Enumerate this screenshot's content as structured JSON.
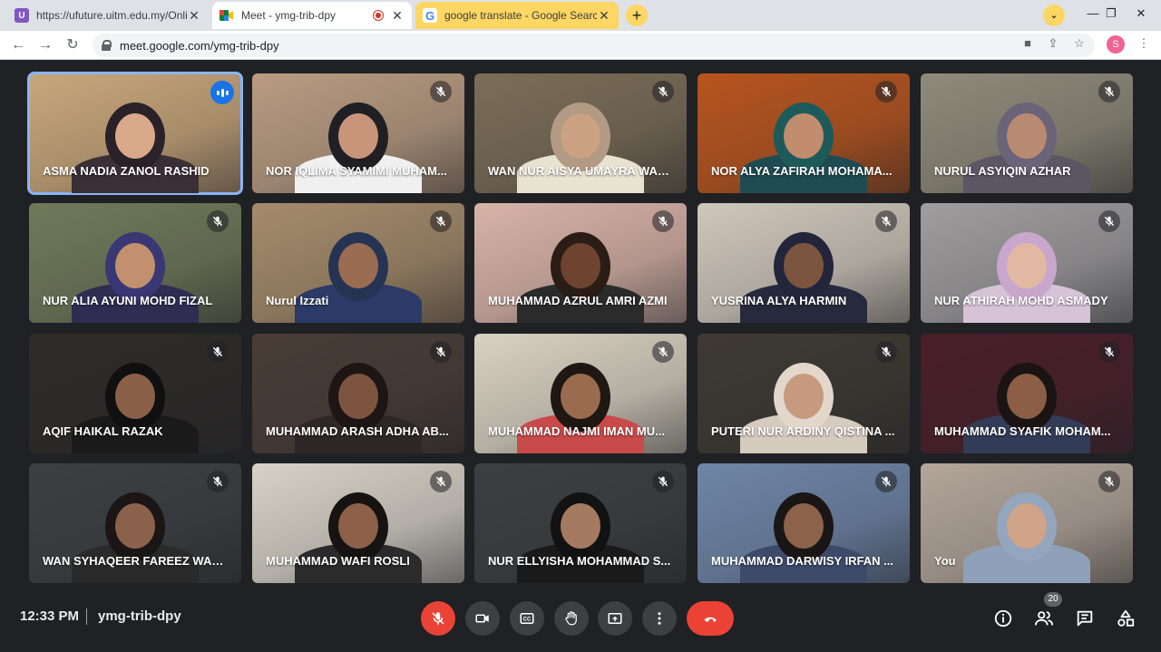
{
  "browser": {
    "tabs": [
      {
        "title": "https://ufuture.uitm.edu.my/Online",
        "favicon": "ufuture-icon"
      },
      {
        "title": "Meet - ymg-trib-dpy",
        "favicon": "meet-icon",
        "recording": true
      },
      {
        "title": "google translate - Google Search",
        "favicon": "google-icon"
      }
    ],
    "new_tab_label": "+",
    "url": "meet.google.com/ymg-trib-dpy",
    "profile_initial": "S",
    "profile_color": "#f06292"
  },
  "participants": [
    {
      "name": "ASMA NADIA ZANOL RASHID",
      "speaking": true,
      "bg": "#c9a77b",
      "shirt": "#3a2f35",
      "skin": "#d9a98a",
      "hijab": "#2a2228"
    },
    {
      "name": "NOR IQLIMA SYAMIMI MUHAM...",
      "muted": true,
      "bg": "#b99c82",
      "shirt": "#f0f0f0",
      "skin": "#c9957a",
      "hijab": "#1f1f24"
    },
    {
      "name": "WAN NUR AISYA UMAYRA WAN...",
      "muted": true,
      "bg": "#7b6d58",
      "shirt": "#e8e2d0",
      "skin": "#caa182",
      "hijab": "#b29a84"
    },
    {
      "name": "NOR ALYA ZAFIRAH MOHAMA...",
      "muted": true,
      "bg": "#b7551f",
      "shirt": "#1f4b52",
      "skin": "#c28c6e",
      "hijab": "#1d5a5a"
    },
    {
      "name": "NURUL ASYIQIN AZHAR",
      "muted": true,
      "bg": "#8f8a7a",
      "shirt": "#5b5564",
      "skin": "#b98a72",
      "hijab": "#6b6478"
    },
    {
      "name": "NUR ALIA AYUNI MOHD FIZAL",
      "muted": true,
      "bg": "#6f7a5a",
      "shirt": "#2f2d52",
      "skin": "#c2906f",
      "hijab": "#3a3775"
    },
    {
      "name": "Nurul Izzati",
      "muted": true,
      "bg": "#a58b6b",
      "shirt": "#2b3a66",
      "skin": "#9a6c52",
      "hijab": "#263454"
    },
    {
      "name": "MUHAMMAD AZRUL AMRI AZMI",
      "muted": true,
      "bg": "#d8b3a8",
      "shirt": "#2b2b2b",
      "skin": "#6e4330",
      "hijab": "#2a1d16"
    },
    {
      "name": "YUSRINA ALYA HARMIN",
      "muted": true,
      "bg": "#cfc7bb",
      "shirt": "#272a3c",
      "skin": "#7c5540",
      "hijab": "#23263a"
    },
    {
      "name": "NUR ATHIRAH MOHD ASMADY",
      "muted": true,
      "bg": "#9f9d9e",
      "shirt": "#d7c3d8",
      "skin": "#e1b9a2",
      "hijab": "#c9a6cc"
    },
    {
      "name": "AQIF HAIKAL RAZAK",
      "muted": true,
      "bg": "#2e2b29",
      "shirt": "#1b1a1a",
      "skin": "#8b6048",
      "hijab": "#111010"
    },
    {
      "name": "MUHAMMAD ARASH ADHA AB...",
      "muted": true,
      "bg": "#4a3d37",
      "shirt": "#2e2727",
      "skin": "#7d5440",
      "hijab": "#1d1614"
    },
    {
      "name": "MUHAMMAD NAJMI IMAN MU...",
      "muted": true,
      "bg": "#d9d2c2",
      "shirt": "#c84a4a",
      "skin": "#9a6b4f",
      "hijab": "#1e1714"
    },
    {
      "name": "PUTERI NUR ARDINY QISTINA ...",
      "muted": true,
      "bg": "#3e3a33",
      "shirt": "#d6cbbf",
      "skin": "#c79a7f",
      "hijab": "#e3d7cc"
    },
    {
      "name": "MUHAMMAD SYAFIK MOHAM...",
      "muted": true,
      "bg": "#4a1f2b",
      "shirt": "#333c56",
      "skin": "#8b5e45",
      "hijab": "#1a1414"
    },
    {
      "name": "WAN SYHAQEER FAREEZ WAN ...",
      "muted": true,
      "bg": "#3c4043",
      "shirt": "#2a2a2a",
      "skin": "#8a624c",
      "hijab": "#1a1616"
    },
    {
      "name": "MUHAMMAD WAFI ROSLI",
      "muted": true,
      "bg": "#d7d2c8",
      "shirt": "#2b2b2b",
      "skin": "#8c6049",
      "hijab": "#171313"
    },
    {
      "name": "NUR ELLYISHA MOHAMMAD S...",
      "muted": true,
      "bg": "#3c4043",
      "shirt": "#1a1a1a",
      "skin": "#a47a61",
      "hijab": "#121212"
    },
    {
      "name": "MUHAMMAD DARWISY IRFAN ...",
      "muted": true,
      "bg": "#6f86a8",
      "shirt": "#3d4a6a",
      "skin": "#8c624a",
      "hijab": "#1b1616"
    },
    {
      "name": "You",
      "muted": true,
      "bg": "#b3a69a",
      "shirt": "#8fa1b8",
      "skin": "#d0a488",
      "hijab": "#93a6bd"
    }
  ],
  "footer": {
    "time": "12:33 PM",
    "separator": "|",
    "meeting_code": "ymg-trib-dpy",
    "participant_count": "20"
  },
  "colors": {
    "background": "#202124",
    "control": "#3c4043",
    "danger": "#ea4335",
    "speaking_outline": "#8ab4f8"
  }
}
